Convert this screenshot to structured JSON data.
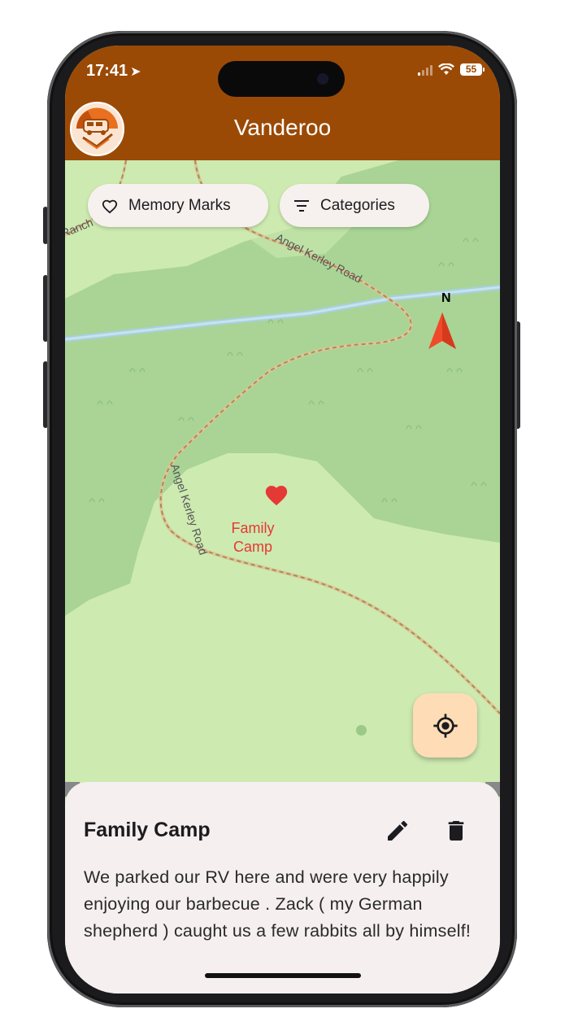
{
  "status_bar": {
    "time": "17:41",
    "battery": "55"
  },
  "app": {
    "title": "Vanderoo"
  },
  "filters": {
    "memory_marks_label": "Memory Marks",
    "categories_label": "Categories"
  },
  "map": {
    "road_labels": [
      "Angel Kerley Road",
      "Angel Kerley Road"
    ],
    "place_label": "Ranch",
    "compass_label": "N",
    "marker": {
      "line1": "Family",
      "line2": "Camp",
      "color": "#e53935"
    }
  },
  "memory": {
    "title": "Family Camp",
    "description": "We parked our RV here and were very happily enjoying our barbecue . Zack ( my German shepherd ) caught us a few rabbits all by himself!"
  },
  "colors": {
    "appbar": "#9b4a06",
    "map_light": "#cdeab0",
    "map_forest": "#a9d495",
    "fab": "#fddcb6",
    "sheet": "#f5efef"
  },
  "icons": [
    "location-arrow-icon",
    "signal-icon",
    "wifi-icon",
    "battery-icon",
    "heart-outline-icon",
    "filter-icon",
    "heart-marker-icon",
    "compass-arrow-icon",
    "my-location-icon",
    "edit-icon",
    "delete-icon"
  ]
}
